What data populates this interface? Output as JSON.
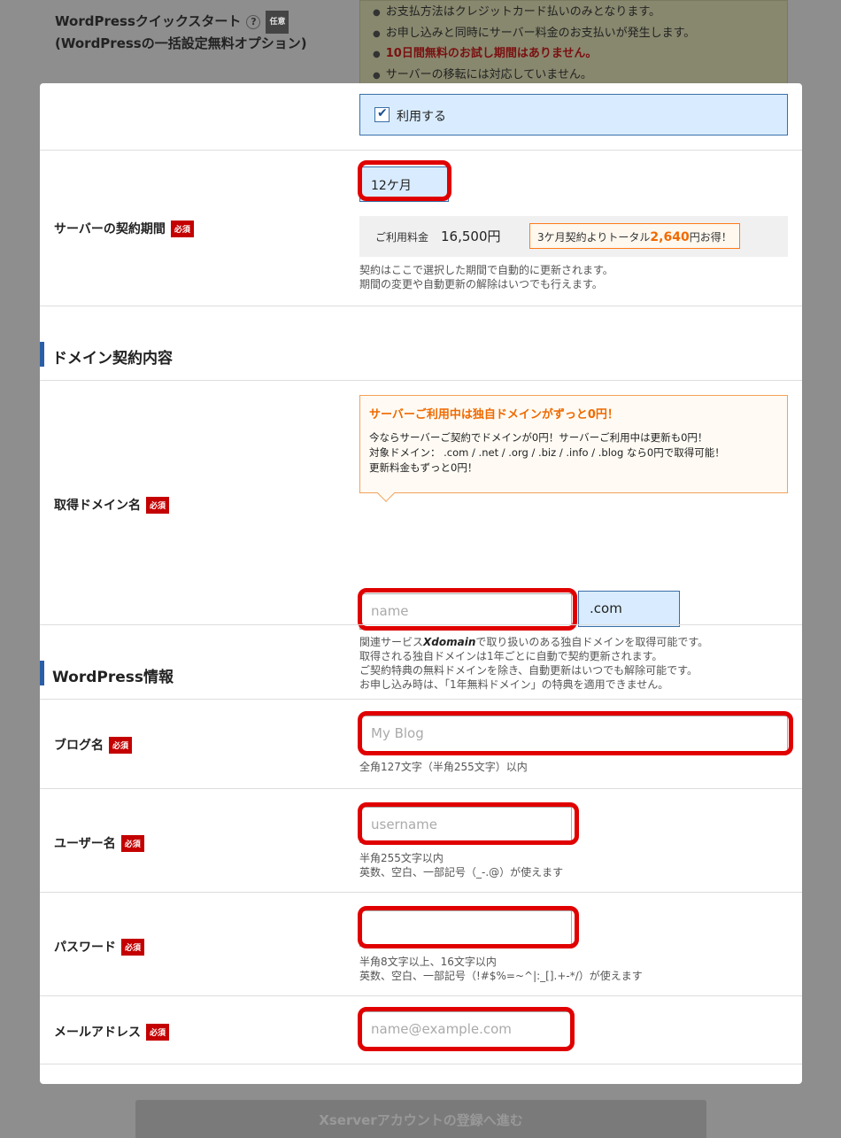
{
  "quickstart": {
    "label_line1": "WordPressクイックスタート",
    "label_line2": "(WordPressの一括設定無料オプション)",
    "help_glyph": "?",
    "optional_badge": "任意",
    "notices": [
      "お支払方法はクレジットカード払いのみとなります。",
      "お申し込みと同時にサーバー料金のお支払いが発生します。",
      "10日間無料のお試し期間はありません。",
      "サーバーの移転には対応していません。"
    ],
    "use_label": "利用する",
    "use_checked": true
  },
  "required_badge": "必須",
  "contract": {
    "label": "サーバーの契約期間",
    "selected": "12ケ月",
    "price_label": "ご利用料金",
    "price_value": "16,500円",
    "savings_prefix": "3ケ月契約よりトータル",
    "savings_amount": "2,640",
    "savings_suffix": "円お得！",
    "help_line1": "契約はここで選択した期間で自動的に更新されます。",
    "help_line2": "期間の変更や自動更新の解除はいつでも行えます。"
  },
  "domain_section": {
    "title": "ドメイン契約内容",
    "label": "取得ドメイン名",
    "promo_title": "サーバーご利用中は独自ドメインがずっと0円！",
    "promo_line1": "今ならサーバーご契約でドメインが0円！サーバーご利用中は更新も0円！",
    "promo_line2": "対象ドメイン： .com / .net / .org / .biz / .info / .blog なら0円で取得可能！",
    "promo_line3": "更新料金もずっと0円！",
    "input_placeholder": "name",
    "tld": ".com",
    "help_line1_prefix": "関連サービス",
    "help_brand": "Xdomain",
    "help_line1_suffix": "で取り扱いのある独自ドメインを取得可能です。",
    "help_line2": "取得される独自ドメインは1年ごとに自動で契約更新されます。",
    "help_line3": "ご契約特典の無料ドメインを除き、自動更新はいつでも解除可能です。",
    "help_line4": "お申し込み時は、「1年無料ドメイン」の特典を適用できません。"
  },
  "wp_section": {
    "title": "WordPress情報",
    "blog_label": "ブログ名",
    "blog_placeholder": "My Blog",
    "blog_help": "全角127文字（半角255文字）以内",
    "user_label": "ユーザー名",
    "user_placeholder": "username",
    "user_help1": "半角255文字以内",
    "user_help2": "英数、空白、一部記号（_-.@）が使えます",
    "pass_label": "パスワード",
    "pass_placeholder": "",
    "pass_help1": "半角8文字以上、16文字以内",
    "pass_help2": "英数、空白、一部記号（!#$%=~^|:_[].+-*/）が使えます",
    "mail_label": "メールアドレス",
    "mail_placeholder": "name@example.com"
  },
  "cta_label": "Xserverアカウントの登録へ進む",
  "colors": {
    "required": "#c40000",
    "highlight_ring": "#e00000",
    "accent_orange": "#ef6a00",
    "section_bar": "#2a5fa8"
  }
}
